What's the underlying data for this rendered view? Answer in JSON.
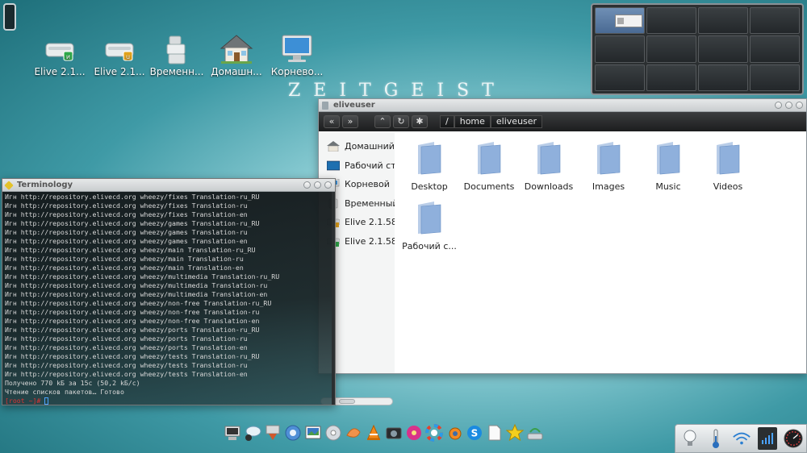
{
  "desktop": {
    "icons": [
      {
        "label": "Elive 2.1...",
        "icon": "drive-green-icon"
      },
      {
        "label": "Elive 2.1...",
        "icon": "drive-yellow-icon"
      },
      {
        "label": "Временн...",
        "icon": "trash-icon"
      },
      {
        "label": "Домашн...",
        "icon": "home-icon"
      },
      {
        "label": "Корнево...",
        "icon": "computer-icon"
      }
    ],
    "wallpaper_text": "ZEITGEIST"
  },
  "file_manager": {
    "title": "eliveuser",
    "path": [
      "/",
      "home",
      "eliveuser"
    ],
    "sidebar": [
      {
        "label": "Домашний",
        "icon": "home-icon"
      },
      {
        "label": "Рабочий стол",
        "icon": "desktop-icon"
      },
      {
        "label": "Корневой",
        "icon": "computer-icon"
      },
      {
        "label": "Временный",
        "icon": "trash-icon"
      },
      {
        "label": "Elive 2.1.58",
        "icon": "drive-yellow-icon"
      },
      {
        "label": "Elive 2.1.58",
        "icon": "drive-green-icon"
      }
    ],
    "folders": [
      "Desktop",
      "Documents",
      "Downloads",
      "Images",
      "Music",
      "Videos",
      "Рабочий с..."
    ]
  },
  "terminal": {
    "title": "Terminology",
    "lines": [
      "Игн http://repository.elivecd.org wheezy/fixes Translation-ru_RU",
      "Игн http://repository.elivecd.org wheezy/fixes Translation-ru",
      "Игн http://repository.elivecd.org wheezy/fixes Translation-en",
      "Игн http://repository.elivecd.org wheezy/games Translation-ru_RU",
      "Игн http://repository.elivecd.org wheezy/games Translation-ru",
      "Игн http://repository.elivecd.org wheezy/games Translation-en",
      "Игн http://repository.elivecd.org wheezy/main Translation-ru_RU",
      "Игн http://repository.elivecd.org wheezy/main Translation-ru",
      "Игн http://repository.elivecd.org wheezy/main Translation-en",
      "Игн http://repository.elivecd.org wheezy/multimedia Translation-ru_RU",
      "Игн http://repository.elivecd.org wheezy/multimedia Translation-ru",
      "Игн http://repository.elivecd.org wheezy/multimedia Translation-en",
      "Игн http://repository.elivecd.org wheezy/non-free Translation-ru_RU",
      "Игн http://repository.elivecd.org wheezy/non-free Translation-ru",
      "Игн http://repository.elivecd.org wheezy/non-free Translation-en",
      "Игн http://repository.elivecd.org wheezy/ports Translation-ru_RU",
      "Игн http://repository.elivecd.org wheezy/ports Translation-ru",
      "Игн http://repository.elivecd.org wheezy/ports Translation-en",
      "Игн http://repository.elivecd.org wheezy/tests Translation-ru_RU",
      "Игн http://repository.elivecd.org wheezy/tests Translation-ru",
      "Игн http://repository.elivecd.org wheezy/tests Translation-en",
      "Получено 770 kБ за 15с (50,2 kБ/c)",
      "Чтение списков пакетов… Готово"
    ],
    "prompt": "[root ~]#"
  },
  "dock": {
    "items": [
      "computer-icon",
      "chat-icon",
      "tools-icon",
      "browser-icon",
      "image-viewer-icon",
      "disc-icon",
      "fruit-icon",
      "vlc-icon",
      "camera-icon",
      "flower-icon",
      "color-wheel-icon",
      "blender-icon",
      "skype-icon",
      "document-icon",
      "star-icon",
      "network-icon"
    ]
  },
  "tray": {
    "items": [
      "lightbulb-icon",
      "thermometer-icon",
      "wifi-icon",
      "battery-icon",
      "clock-icon"
    ]
  },
  "colors": {
    "accent": "#4a6a93",
    "folder": "#8fb0dc",
    "terminal_prompt": "#dd3333"
  }
}
